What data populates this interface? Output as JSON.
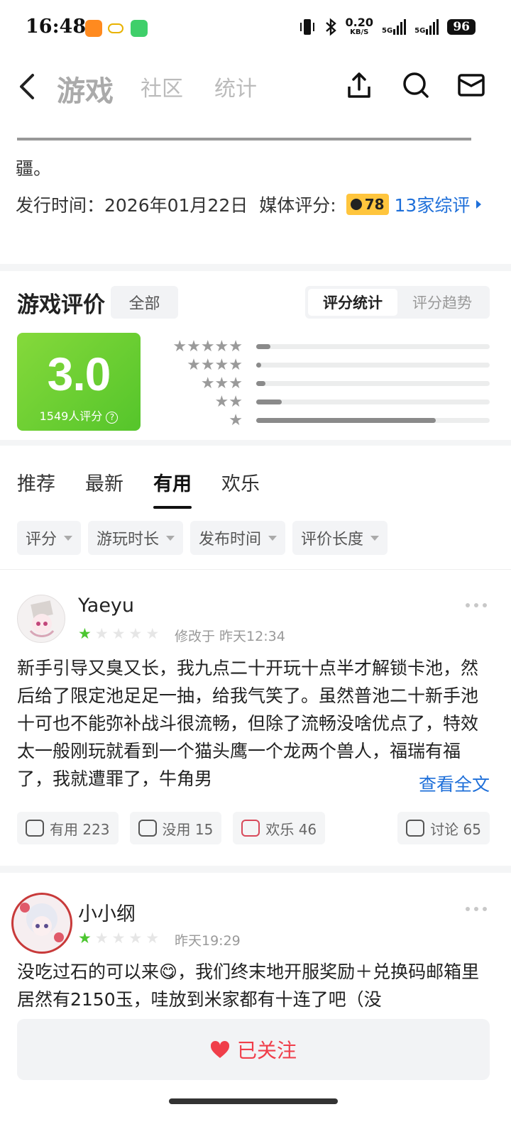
{
  "status": {
    "time": "16:48",
    "speed_value": "0.20",
    "speed_unit": "KB/S",
    "net1": "5G",
    "net2": "5G",
    "battery": "96"
  },
  "nav": {
    "tab_game": "游戏",
    "tab_community": "社区",
    "tab_stats": "统计"
  },
  "game": {
    "desc_tail": "疆。",
    "release_label": "发行时间：2026年01月22日",
    "media_label": "媒体评分:",
    "media_score": "78",
    "media_link": "13家综评"
  },
  "rating": {
    "title": "游戏评价",
    "filter_all": "全部",
    "seg_stats": "评分统计",
    "seg_trend": "评分趋势",
    "score": "3.0",
    "count": "1549人评分",
    "distribution": [
      {
        "stars": 5,
        "fraction": 0.06
      },
      {
        "stars": 4,
        "fraction": 0.02
      },
      {
        "stars": 3,
        "fraction": 0.04
      },
      {
        "stars": 2,
        "fraction": 0.11
      },
      {
        "stars": 1,
        "fraction": 0.77
      }
    ]
  },
  "review_tabs": [
    "推荐",
    "最新",
    "有用",
    "欢乐"
  ],
  "filters": [
    "评分",
    "游玩时长",
    "发布时间",
    "评价长度"
  ],
  "reviews": [
    {
      "name": "Yaeyu",
      "stars": 1,
      "meta": "修改于  昨天12:34",
      "body": "新手引导又臭又长，我九点二十开玩十点半才解锁卡池，然后给了限定池足足一抽，给我气笑了。虽然普池二十新手池十可也不能弥补战斗很流畅，但除了流畅没啥优点了，特效太一般刚玩就看到一个猫头鹰一个龙两个兽人，福瑞有福了，我就遭罪了，牛角男",
      "more": "查看全文",
      "useful": "有用 223",
      "useless": "没用 15",
      "fun": "欢乐 46",
      "discuss": "讨论 65"
    },
    {
      "name": "小小纲",
      "stars": 1,
      "meta": "昨天19:29",
      "body": "没吃过石的可以来😋，我们终末地开服奖励＋兑换码邮箱里居然有2150玉，哇放到米家都有十连了吧（没"
    }
  ],
  "follow": {
    "label": "已关注"
  },
  "colors": {
    "accent_green": "#55c52b",
    "link_blue": "#1e6fd9",
    "follow_red": "#f03e4a",
    "badge_yellow": "#ffc53d"
  }
}
